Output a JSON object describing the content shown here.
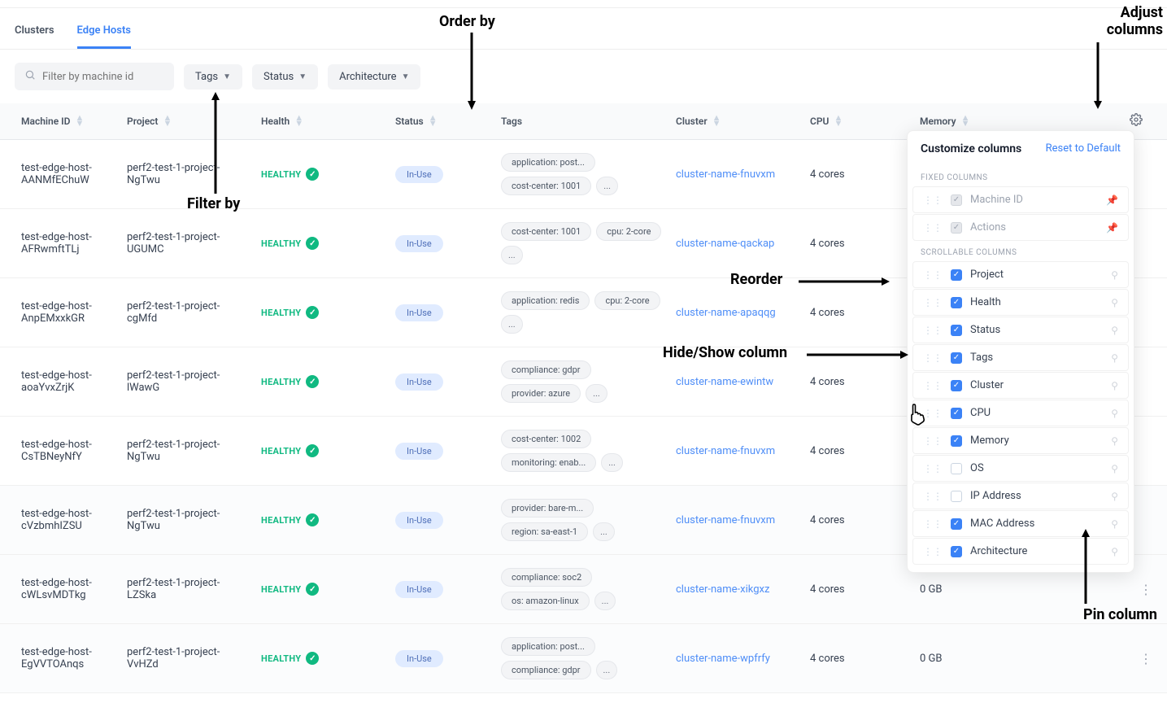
{
  "tabs": {
    "clusters": "Clusters",
    "edgeHosts": "Edge Hosts"
  },
  "filters": {
    "search_placeholder": "Filter by machine id",
    "tags": "Tags",
    "status": "Status",
    "arch": "Architecture"
  },
  "headers": {
    "machineId": "Machine ID",
    "project": "Project",
    "health": "Health",
    "status": "Status",
    "tags": "Tags",
    "cluster": "Cluster",
    "cpu": "CPU",
    "memory": "Memory"
  },
  "health_label": "HEALTHY",
  "status_label": "In-Use",
  "more_tag": "...",
  "rows": [
    {
      "mid": "test-edge-host-AANMfEChuW",
      "proj": "perf2-test-1-project-NgTwu",
      "tags": [
        "application: post...",
        "cost-center: 1001"
      ],
      "cluster": "cluster-name-fnuvxm",
      "cpu": "4 cores",
      "mem": ""
    },
    {
      "mid": "test-edge-host-AFRwmftTLj",
      "proj": "perf2-test-1-project-UGUMC",
      "tags": [
        "cost-center: 1001",
        "cpu: 2-core"
      ],
      "cluster": "cluster-name-qackap",
      "cpu": "4 cores",
      "mem": ""
    },
    {
      "mid": "test-edge-host-AnpEMxxkGR",
      "proj": "perf2-test-1-project-cgMfd",
      "tags": [
        "application: redis",
        "cpu: 2-core"
      ],
      "cluster": "cluster-name-apaqqg",
      "cpu": "4 cores",
      "mem": ""
    },
    {
      "mid": "test-edge-host-aoaYvxZrjK",
      "proj": "perf2-test-1-project-lWawG",
      "tags": [
        "compliance: gdpr",
        "provider: azure"
      ],
      "cluster": "cluster-name-ewintw",
      "cpu": "4 cores",
      "mem": ""
    },
    {
      "mid": "test-edge-host-CsTBNeyNfY",
      "proj": "perf2-test-1-project-NgTwu",
      "tags": [
        "cost-center: 1002",
        "monitoring: enab..."
      ],
      "cluster": "cluster-name-fnuvxm",
      "cpu": "4 cores",
      "mem": ""
    },
    {
      "mid": "test-edge-host-cVzbmhIZSU",
      "proj": "perf2-test-1-project-NgTwu",
      "tags": [
        "provider: bare-m...",
        "region: sa-east-1"
      ],
      "cluster": "cluster-name-fnuvxm",
      "cpu": "4 cores",
      "mem": ""
    },
    {
      "mid": "test-edge-host-cWLsvMDTkg",
      "proj": "perf2-test-1-project-LZSka",
      "tags": [
        "compliance: soc2",
        "os: amazon-linux"
      ],
      "cluster": "cluster-name-xikgxz",
      "cpu": "4 cores",
      "mem": "0 GB"
    },
    {
      "mid": "test-edge-host-EgVVTOAnqs",
      "proj": "perf2-test-1-project-VvHZd",
      "tags": [
        "application: post...",
        "compliance: gdpr"
      ],
      "cluster": "cluster-name-wpfrfy",
      "cpu": "4 cores",
      "mem": "0 GB"
    }
  ],
  "popover": {
    "title": "Customize columns",
    "reset": "Reset to Default",
    "fixed_label": "FIXED COLUMNS",
    "scroll_label": "SCROLLABLE COLUMNS",
    "fixed": [
      "Machine ID",
      "Actions"
    ],
    "scroll": [
      {
        "label": "Project",
        "on": true
      },
      {
        "label": "Health",
        "on": true
      },
      {
        "label": "Status",
        "on": true
      },
      {
        "label": "Tags",
        "on": true
      },
      {
        "label": "Cluster",
        "on": true
      },
      {
        "label": "CPU",
        "on": true
      },
      {
        "label": "Memory",
        "on": true
      },
      {
        "label": "OS",
        "on": false
      },
      {
        "label": "IP Address",
        "on": false
      },
      {
        "label": "MAC Address",
        "on": true
      },
      {
        "label": "Architecture",
        "on": true
      }
    ]
  },
  "annotations": {
    "adjust": "Adjust columns",
    "orderby": "Order by",
    "filterby": "Filter by",
    "reorder": "Reorder",
    "hideshow": "Hide/Show column",
    "pin": "Pin column"
  }
}
